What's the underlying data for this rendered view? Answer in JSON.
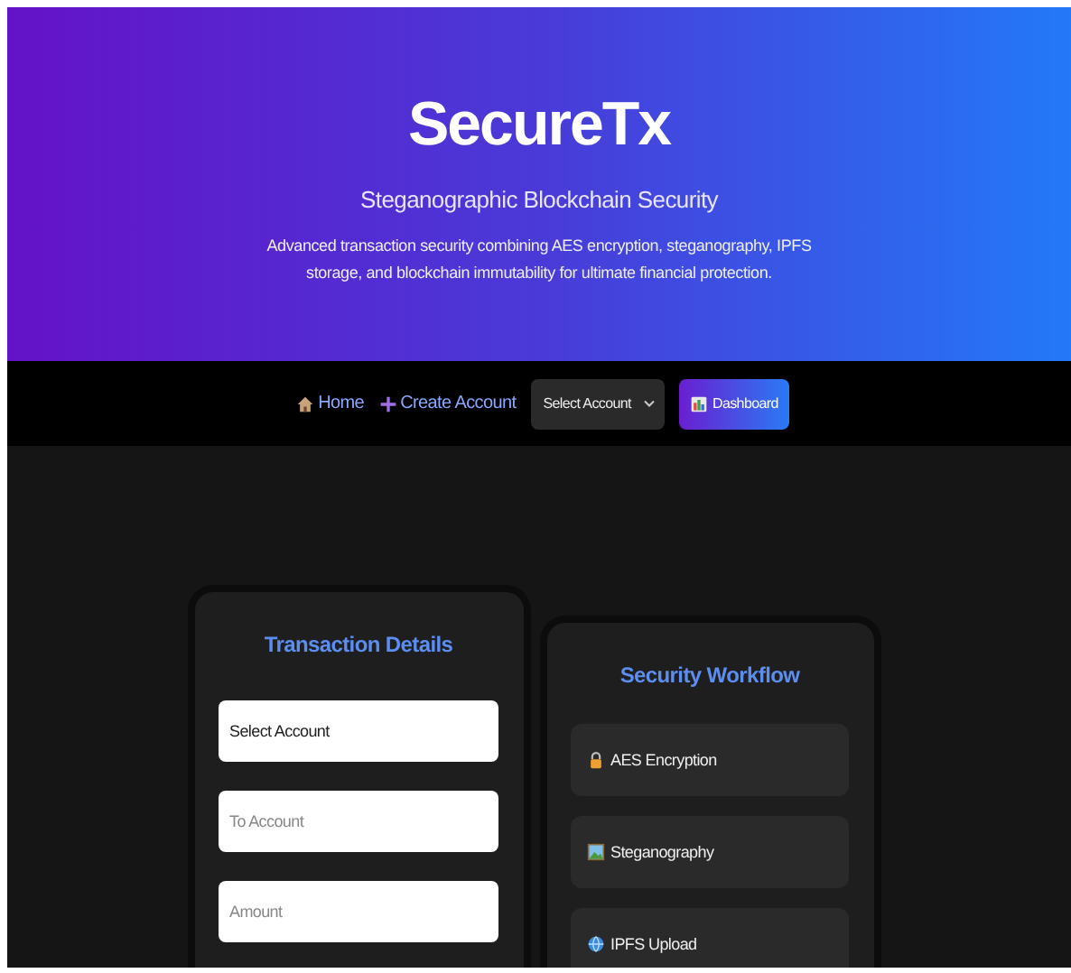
{
  "header": {
    "title": "SecureTx",
    "subtitle": "Steganographic Blockchain Security",
    "description": "Advanced transaction security combining AES encryption, steganography, IPFS storage, and blockchain immutability for ultimate financial protection."
  },
  "nav": {
    "links": [
      "Home",
      "Create Account"
    ],
    "account_select": "Select Account",
    "dashboard_button": "Dashboard"
  },
  "transaction_card": {
    "title": "Transaction Details",
    "fields": [
      {
        "kind": "select",
        "value": "Select Account"
      },
      {
        "kind": "input",
        "placeholder": "To Account"
      },
      {
        "kind": "input",
        "placeholder": "Amount"
      }
    ]
  },
  "workflow_card": {
    "title": "Security Workflow",
    "steps": [
      "AES Encryption",
      "Steganography",
      "IPFS Upload"
    ]
  }
}
